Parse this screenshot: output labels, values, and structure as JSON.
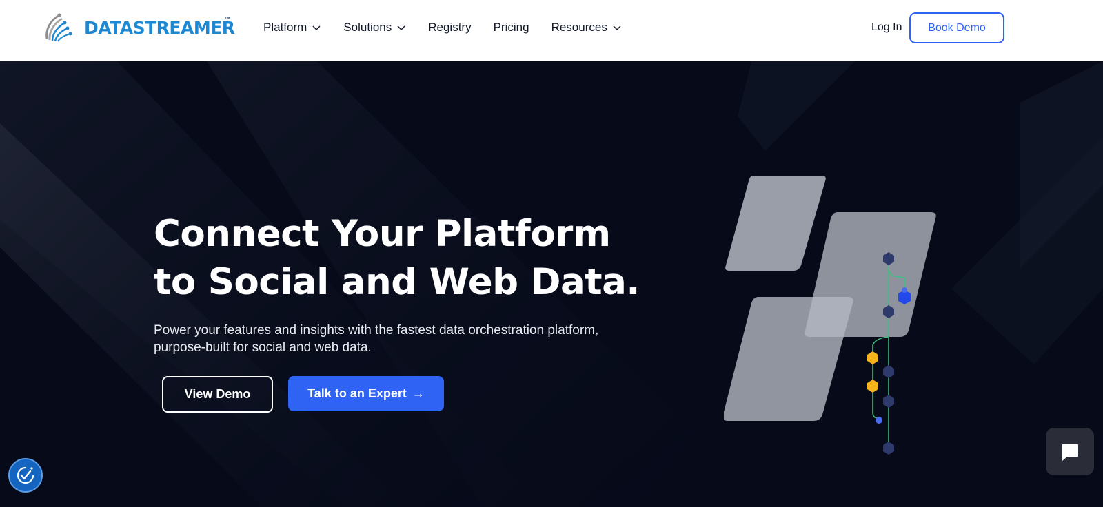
{
  "brand": {
    "name": "DATASTREAMER",
    "trademark": "™",
    "logo_icon": "datastreamer-logo-icon",
    "color": "#1e88d2"
  },
  "nav": {
    "items": [
      {
        "label": "Platform",
        "has_dropdown": true
      },
      {
        "label": "Solutions",
        "has_dropdown": true
      },
      {
        "label": "Registry",
        "has_dropdown": false
      },
      {
        "label": "Pricing",
        "has_dropdown": false
      },
      {
        "label": "Resources",
        "has_dropdown": true
      }
    ],
    "login_label": "Log In",
    "book_demo_label": "Book Demo"
  },
  "hero": {
    "headline_line1": "Connect Your Platform",
    "headline_line2": "to Social and Web Data.",
    "subheadline": "Power your features and insights with the fastest data orchestration platform, purpose-built for social and web data.",
    "primary_button_label": "View Demo",
    "secondary_button_label": "Talk to an Expert",
    "secondary_button_icon": "arrow-right-icon"
  },
  "widgets": {
    "chat_icon": "chat-bubble-icon",
    "accessibility_icon": "accessibility-check-icon"
  },
  "colors": {
    "accent_blue": "#2f63f4",
    "hero_bg": "#060a19",
    "node_yellow": "#f5b21a",
    "node_navy": "#2e3a6b",
    "line_green": "#3fbf7f"
  }
}
